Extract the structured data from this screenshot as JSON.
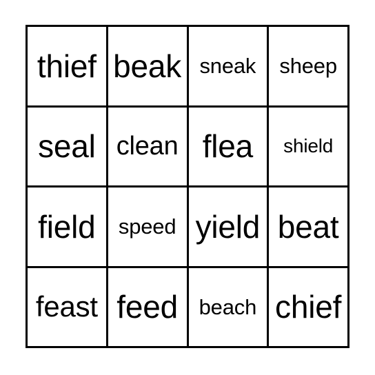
{
  "card": {
    "type": "bingo-card",
    "columns": 4,
    "rows": 4,
    "background_color": "#ffffff",
    "border_color": "#000000",
    "text_color": "#000000",
    "cells": [
      {
        "text": "thief",
        "row": 1,
        "col": 1,
        "size_class": "fs-xl"
      },
      {
        "text": "beak",
        "row": 1,
        "col": 2,
        "size_class": "fs-xl"
      },
      {
        "text": "sneak",
        "row": 1,
        "col": 3,
        "size_class": "fs-sm"
      },
      {
        "text": "sheep",
        "row": 1,
        "col": 4,
        "size_class": "fs-sm"
      },
      {
        "text": "seal",
        "row": 2,
        "col": 1,
        "size_class": "fs-xl"
      },
      {
        "text": "clean",
        "row": 2,
        "col": 2,
        "size_class": "fs-md"
      },
      {
        "text": "flea",
        "row": 2,
        "col": 3,
        "size_class": "fs-xl"
      },
      {
        "text": "shield",
        "row": 2,
        "col": 4,
        "size_class": "fs-xs"
      },
      {
        "text": "field",
        "row": 3,
        "col": 1,
        "size_class": "fs-xl"
      },
      {
        "text": "speed",
        "row": 3,
        "col": 2,
        "size_class": "fs-sm"
      },
      {
        "text": "yield",
        "row": 3,
        "col": 3,
        "size_class": "fs-xl"
      },
      {
        "text": "beat",
        "row": 3,
        "col": 4,
        "size_class": "fs-xl"
      },
      {
        "text": "feast",
        "row": 4,
        "col": 1,
        "size_class": "fs-lg"
      },
      {
        "text": "feed",
        "row": 4,
        "col": 2,
        "size_class": "fs-xl"
      },
      {
        "text": "beach",
        "row": 4,
        "col": 3,
        "size_class": "fs-sm"
      },
      {
        "text": "chief",
        "row": 4,
        "col": 4,
        "size_class": "fs-xl"
      }
    ]
  }
}
